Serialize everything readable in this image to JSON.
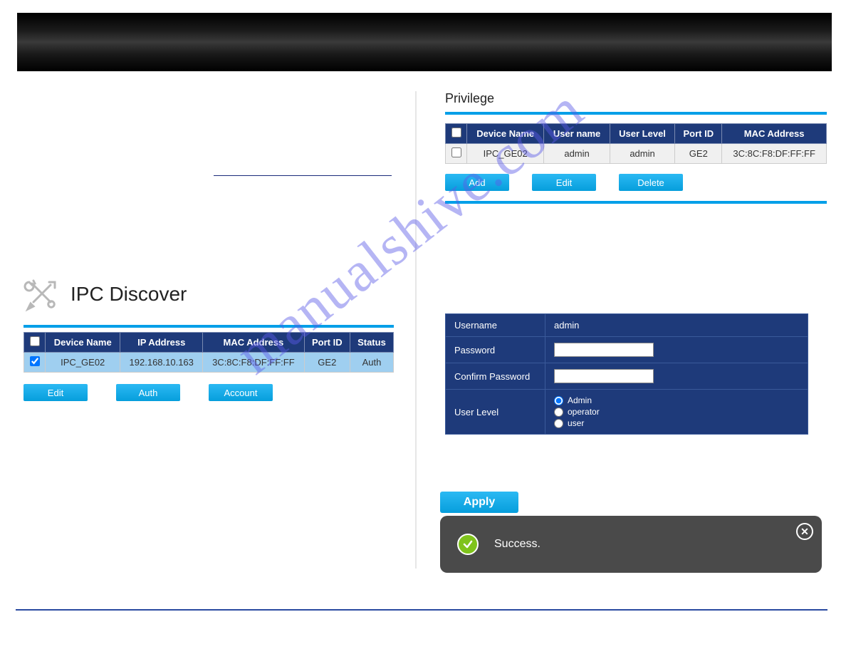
{
  "watermark": "manualshive.com",
  "privilege": {
    "title": "Privilege",
    "columns": [
      "Device Name",
      "User name",
      "User Level",
      "Port ID",
      "MAC Address"
    ],
    "rows": [
      {
        "checked": false,
        "device_name": "IPC_GE02",
        "user_name": "admin",
        "user_level": "admin",
        "port_id": "GE2",
        "mac": "3C:8C:F8:DF:FF:FF"
      }
    ],
    "buttons": {
      "add": "Add",
      "edit": "Edit",
      "delete": "Delete"
    }
  },
  "ipc_discover": {
    "title": "IPC Discover",
    "columns": [
      "Device Name",
      "IP Address",
      "MAC Address",
      "Port ID",
      "Status"
    ],
    "rows": [
      {
        "checked": true,
        "device_name": "IPC_GE02",
        "ip": "192.168.10.163",
        "mac": "3C:8C:F8:DF:FF:FF",
        "port_id": "GE2",
        "status": "Auth"
      }
    ],
    "buttons": {
      "edit": "Edit",
      "auth": "Auth",
      "account": "Account"
    }
  },
  "account_form": {
    "username_label": "Username",
    "username_value": "admin",
    "password_label": "Password",
    "password_value": "",
    "confirm_label": "Confirm Password",
    "confirm_value": "",
    "userlevel_label": "User Level",
    "levels": {
      "admin": "Admin",
      "operator": "operator",
      "user": "user"
    },
    "selected_level": "admin"
  },
  "apply_label": "Apply",
  "toast": {
    "message": "Success."
  }
}
